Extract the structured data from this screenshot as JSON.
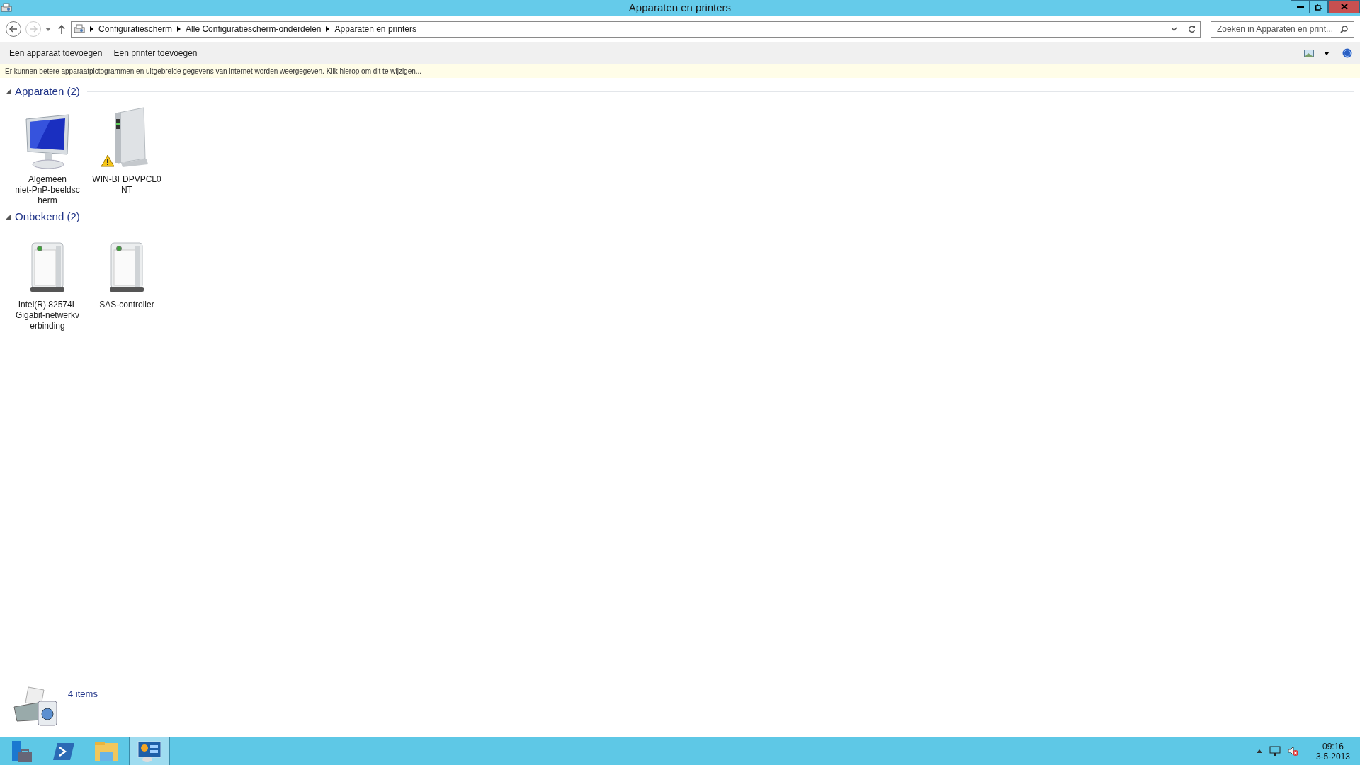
{
  "window": {
    "title": "Apparaten en printers"
  },
  "address_bar": {
    "breadcrumbs": [
      "Configuratiescherm",
      "Alle Configuratiescherm-onderdelen",
      "Apparaten en printers"
    ]
  },
  "search": {
    "placeholder": "Zoeken in Apparaten en print..."
  },
  "toolbar": {
    "buttons": [
      "Een apparaat toevoegen",
      "Een printer toevoegen"
    ]
  },
  "info_bar": {
    "text": "Er kunnen betere apparaatpictogrammen en uitgebreide gegevens van internet worden weergegeven. Klik hierop om dit te wijzigen..."
  },
  "groups": [
    {
      "title": "Apparaten (2)",
      "expanded": true,
      "items": [
        {
          "kind": "monitor",
          "label_lines": [
            "Algemeen",
            "niet-PnP-beeldsc",
            "herm"
          ],
          "warning": false
        },
        {
          "kind": "computer",
          "label_lines": [
            "WIN-BFDPVPCL0",
            "NT"
          ],
          "warning": true
        }
      ]
    },
    {
      "title": "Onbekend (2)",
      "expanded": true,
      "items": [
        {
          "kind": "device",
          "label_lines": [
            "Intel(R) 82574L",
            "Gigabit-netwerkv",
            "erbinding"
          ],
          "warning": false
        },
        {
          "kind": "device",
          "label_lines": [
            "SAS-controller"
          ],
          "warning": false
        }
      ]
    }
  ],
  "status_bar": {
    "count": "4 items"
  },
  "taskbar": {
    "apps": [
      {
        "kind": "server-manager",
        "selected": false
      },
      {
        "kind": "powershell",
        "selected": false
      },
      {
        "kind": "explorer",
        "selected": false
      },
      {
        "kind": "control-panel",
        "selected": true
      }
    ],
    "clock": {
      "time": "09:16",
      "date": "3-5-2013"
    }
  }
}
